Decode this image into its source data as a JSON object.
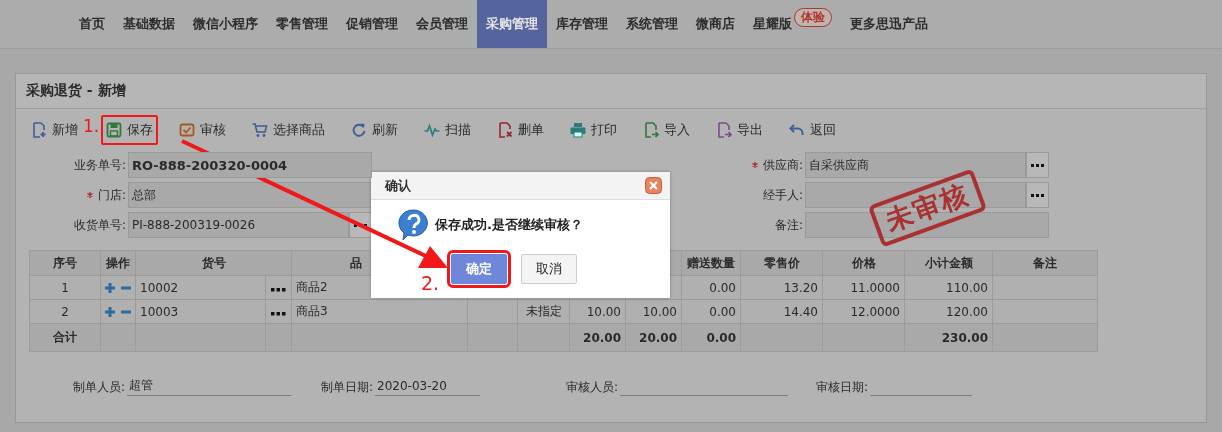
{
  "nav": {
    "items": [
      {
        "label": "首页",
        "selected": false
      },
      {
        "label": "基础数据",
        "selected": false
      },
      {
        "label": "微信小程序",
        "selected": false
      },
      {
        "label": "零售管理",
        "selected": false
      },
      {
        "label": "促销管理",
        "selected": false
      },
      {
        "label": "会员管理",
        "selected": false
      },
      {
        "label": "采购管理",
        "selected": true
      },
      {
        "label": "库存管理",
        "selected": false
      },
      {
        "label": "系统管理",
        "selected": false
      },
      {
        "label": "微商店",
        "selected": false
      },
      {
        "label": "星耀版",
        "selected": false,
        "badge": "体验"
      },
      {
        "label": "更多思迅产品",
        "selected": false
      }
    ]
  },
  "panel": {
    "title": "采购退货 - 新增"
  },
  "toolbar": [
    {
      "kind": "add",
      "label": "新增",
      "marked": false
    },
    {
      "kind": "save",
      "label": "保存",
      "marked": true
    },
    {
      "kind": "audit",
      "label": "审核",
      "marked": false
    },
    {
      "kind": "cart",
      "label": "选择商品",
      "marked": false
    },
    {
      "kind": "refresh",
      "label": "刷新",
      "marked": false
    },
    {
      "kind": "scan",
      "label": "扫描",
      "marked": false
    },
    {
      "kind": "delete",
      "label": "删单",
      "marked": false
    },
    {
      "kind": "print",
      "label": "打印",
      "marked": false
    },
    {
      "kind": "import",
      "label": "导入",
      "marked": false
    },
    {
      "kind": "export",
      "label": "导出",
      "marked": false
    },
    {
      "kind": "back",
      "label": "返回",
      "marked": false
    }
  ],
  "form": {
    "left": [
      {
        "label": "业务单号:",
        "value": "RO-888-200320-0004",
        "required": false,
        "kind": "primary"
      },
      {
        "label": "门店:",
        "value": "总部",
        "required": true,
        "kind": "text"
      },
      {
        "label": "收货单号:",
        "value": "PI-888-200319-0026",
        "required": false,
        "kind": "lookup"
      }
    ],
    "right": [
      {
        "label": "供应商:",
        "value": "自采供应商",
        "required": true,
        "kind": "lookup"
      },
      {
        "label": "经手人:",
        "required": false,
        "kind": "lookup"
      },
      {
        "label": "备注:",
        "required": false,
        "kind": "text"
      }
    ]
  },
  "stamp": "未审核",
  "table": {
    "columns": [
      "序号",
      "操作",
      "货号",
      "",
      "品",
      "",
      "",
      "",
      "",
      "赠送数量",
      "零售价",
      "价格",
      "小计金额",
      "备注"
    ],
    "rows": [
      {
        "kind": "item",
        "cells": [
          "1",
          "",
          "10002",
          "",
          "商品2",
          "",
          "",
          "",
          "",
          "0.00",
          "13.20",
          "11.0000",
          "110.00",
          ""
        ]
      },
      {
        "kind": "item",
        "cells": [
          "2",
          "",
          "10003",
          "",
          "商品3",
          "",
          "未指定",
          "10.00",
          "10.00",
          "0.00",
          "14.40",
          "12.0000",
          "120.00",
          ""
        ]
      },
      {
        "kind": "total",
        "cells": [
          "合计",
          "",
          "",
          "",
          "",
          "",
          "",
          "20.00",
          "20.00",
          "0.00",
          "",
          "",
          "230.00",
          ""
        ]
      }
    ]
  },
  "footer": [
    {
      "label": "制单人员:",
      "value": "超管"
    },
    {
      "label": "制单日期:",
      "value": "2020-03-20"
    },
    {
      "label": "审核人员:"
    },
    {
      "label": "审核日期:"
    }
  ],
  "dialog": {
    "title": "确认",
    "message": "保存成功.是否继续审核？",
    "buttons": [
      {
        "label": "确定",
        "kind": "primary",
        "marked": true
      },
      {
        "label": "取消",
        "kind": "default",
        "marked": false
      }
    ]
  },
  "annotations": [
    "1.",
    "2."
  ]
}
